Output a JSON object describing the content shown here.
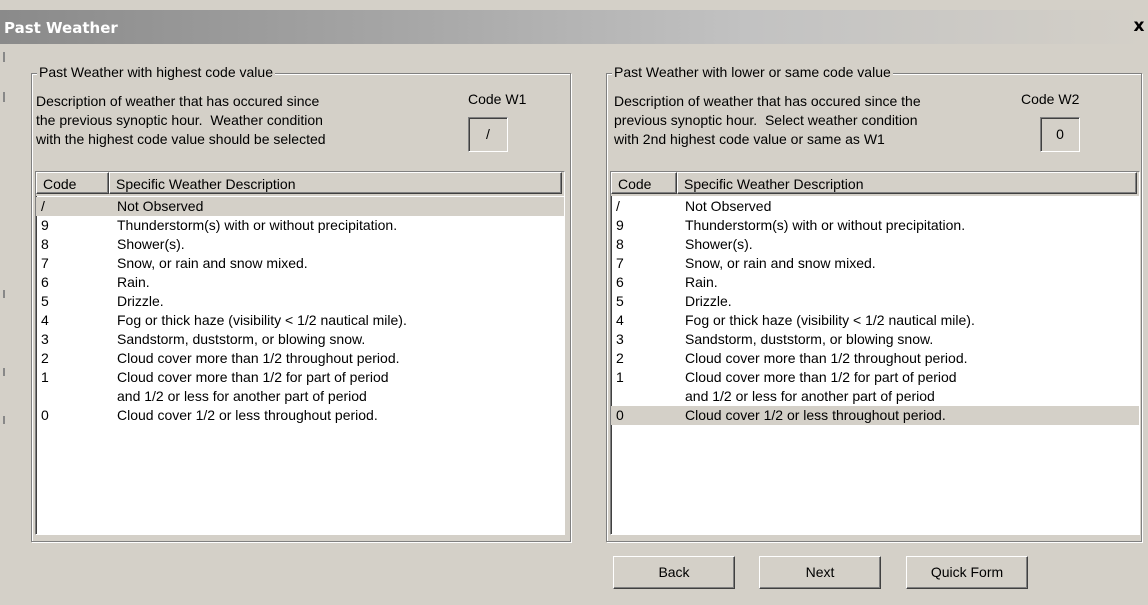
{
  "window": {
    "title": "Past Weather",
    "close_label": "x"
  },
  "left_panel": {
    "legend": "Past Weather with highest code value",
    "description": "Description of weather that has occured since\nthe previous synoptic hour.  Weather condition\nwith the highest code value should be selected",
    "code_label": "Code W1",
    "code_value": "/",
    "headers": {
      "code": "Code",
      "description": "Specific Weather Description"
    },
    "rows": [
      {
        "code": "/",
        "desc": "Not Observed",
        "selected": true
      },
      {
        "code": "9",
        "desc": "Thunderstorm(s) with or without precipitation.",
        "selected": false
      },
      {
        "code": "8",
        "desc": "Shower(s).",
        "selected": false
      },
      {
        "code": "7",
        "desc": "Snow, or rain and snow mixed.",
        "selected": false
      },
      {
        "code": "6",
        "desc": "Rain.",
        "selected": false
      },
      {
        "code": "5",
        "desc": "Drizzle.",
        "selected": false
      },
      {
        "code": "4",
        "desc": "Fog or thick haze (visibility < 1/2 nautical mile).",
        "selected": false
      },
      {
        "code": "3",
        "desc": "Sandstorm, duststorm, or blowing snow.",
        "selected": false
      },
      {
        "code": "2",
        "desc": "Cloud cover more than 1/2 throughout period.",
        "selected": false
      },
      {
        "code": "1",
        "desc": "Cloud cover more than 1/2 for part of period",
        "selected": false
      },
      {
        "code": "",
        "desc": "and 1/2 or less for another part of period",
        "selected": false
      },
      {
        "code": "0",
        "desc": "Cloud cover 1/2 or less throughout period.",
        "selected": false
      }
    ]
  },
  "right_panel": {
    "legend": "Past Weather with lower or same code value",
    "description": "Description of weather that has occured since the\nprevious synoptic hour.  Select weather condition\nwith 2nd highest code value or same as W1",
    "code_label": "Code  W2",
    "code_value": "0",
    "headers": {
      "code": "Code",
      "description": "Specific Weather Description"
    },
    "rows": [
      {
        "code": "/",
        "desc": "Not Observed",
        "selected": false
      },
      {
        "code": "9",
        "desc": "Thunderstorm(s) with or without precipitation.",
        "selected": false
      },
      {
        "code": "8",
        "desc": "Shower(s).",
        "selected": false
      },
      {
        "code": "7",
        "desc": "Snow, or rain and snow mixed.",
        "selected": false
      },
      {
        "code": "6",
        "desc": "Rain.",
        "selected": false
      },
      {
        "code": "5",
        "desc": "Drizzle.",
        "selected": false
      },
      {
        "code": "4",
        "desc": "Fog or thick haze (visibility < 1/2 nautical mile).",
        "selected": false
      },
      {
        "code": "3",
        "desc": "Sandstorm, duststorm, or blowing snow.",
        "selected": false
      },
      {
        "code": "2",
        "desc": "Cloud cover more than 1/2 throughout period.",
        "selected": false
      },
      {
        "code": "1",
        "desc": "Cloud cover more than 1/2 for part of period",
        "selected": false
      },
      {
        "code": "",
        "desc": "and 1/2 or less for another part of period",
        "selected": false
      },
      {
        "code": "0",
        "desc": "Cloud cover 1/2 or less throughout period.",
        "selected": true
      }
    ]
  },
  "buttons": {
    "back": "Back",
    "next": "Next",
    "quick_form": "Quick Form"
  }
}
